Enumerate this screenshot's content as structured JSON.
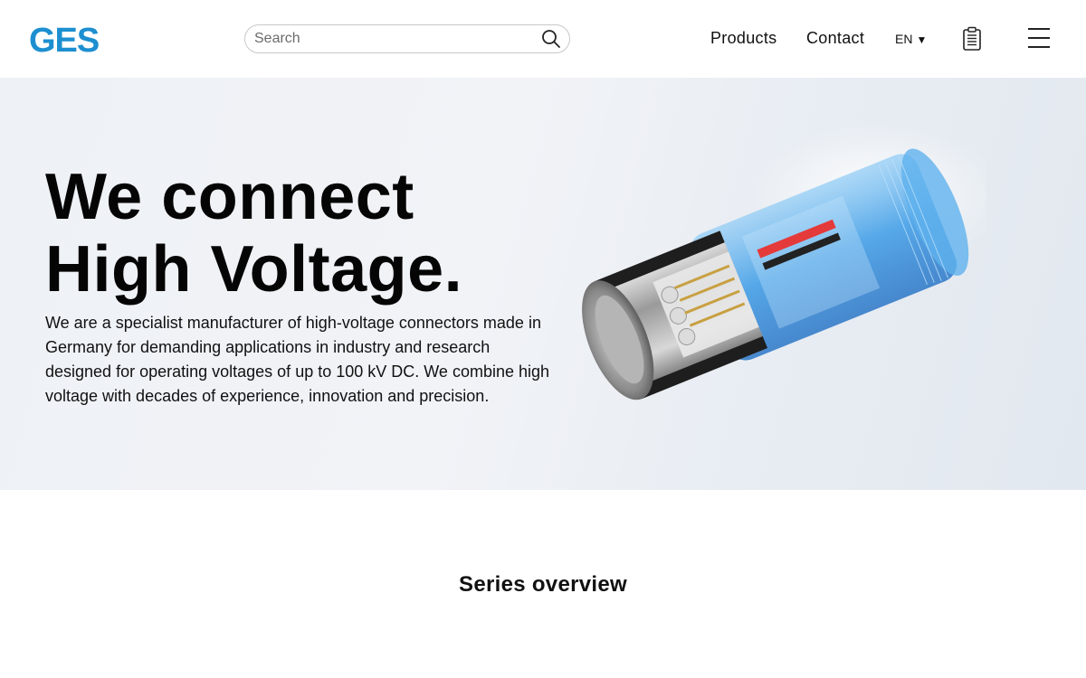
{
  "header": {
    "logo_text": "GES",
    "search_placeholder": "Search",
    "nav": {
      "products": "Products",
      "contact": "Contact"
    },
    "language": "EN",
    "icons": [
      "search-icon",
      "clipboard-icon",
      "hamburger-menu-icon",
      "chevron-down-icon"
    ]
  },
  "hero": {
    "title_line1": "We connect",
    "title_line2": "High Voltage.",
    "description": "We are a specialist manufacturer of high-voltage connectors made in Germany for demanding applications in industry and research designed for operating voltages of up to 100 kV DC. We combine high voltage with decades of experience, innovation and precision."
  },
  "series": {
    "title": "Series overview"
  },
  "colors": {
    "brand_blue": "#1d8fd1",
    "hero_bg": "#eef1f5",
    "text": "#111111"
  }
}
